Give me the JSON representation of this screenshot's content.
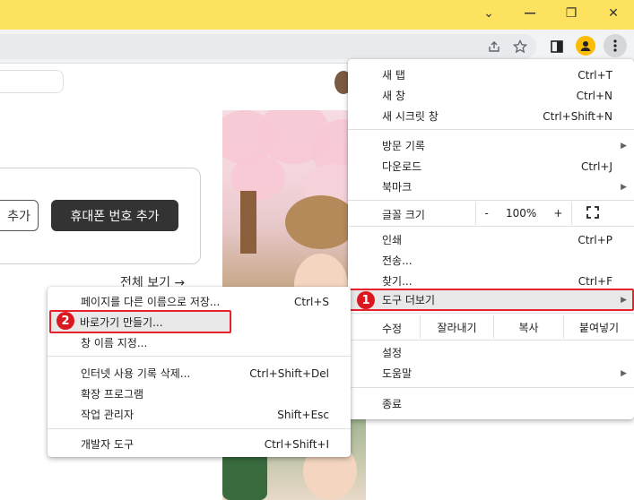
{
  "window": {
    "minimize": "⌄",
    "restore": "❐",
    "close": "✕"
  },
  "toolbar": {
    "share_icon": "share-icon",
    "bookmark_icon": "star-icon",
    "sidepanel_icon": "side-panel-icon",
    "profile_icon": "profile-icon",
    "menu_icon": "kebab-menu-icon"
  },
  "page": {
    "outline_button": "추가",
    "dark_button": "휴대폰 번호 추가",
    "view_all": "전체 보기 →"
  },
  "menu": {
    "new_tab": {
      "label": "새 탭",
      "shortcut": "Ctrl+T"
    },
    "new_window": {
      "label": "새 창",
      "shortcut": "Ctrl+N"
    },
    "incognito": {
      "label": "새 시크릿 창",
      "shortcut": "Ctrl+Shift+N"
    },
    "history": {
      "label": "방문 기록"
    },
    "downloads": {
      "label": "다운로드",
      "shortcut": "Ctrl+J"
    },
    "bookmarks": {
      "label": "북마크"
    },
    "zoom": {
      "label": "글꼴 크기",
      "minus": "-",
      "value": "100%",
      "plus": "+"
    },
    "print": {
      "label": "인쇄",
      "shortcut": "Ctrl+P"
    },
    "cast": {
      "label": "전송..."
    },
    "find": {
      "label": "찾기...",
      "shortcut": "Ctrl+F"
    },
    "more_tools": {
      "label": "도구 더보기"
    },
    "edit": {
      "label": "수정",
      "cut": "잘라내기",
      "copy": "복사",
      "paste": "붙여넣기"
    },
    "settings": {
      "label": "설정"
    },
    "help": {
      "label": "도움말"
    },
    "exit": {
      "label": "종료"
    }
  },
  "submenu": {
    "save_as": {
      "label": "페이지를 다른 이름으로 저장...",
      "shortcut": "Ctrl+S"
    },
    "create_shortcut": {
      "label": "바로가기 만들기..."
    },
    "name_window": {
      "label": "창 이름 지정..."
    },
    "clear_data": {
      "label": "인터넷 사용 기록 삭제...",
      "shortcut": "Ctrl+Shift+Del"
    },
    "extensions": {
      "label": "확장 프로그램"
    },
    "task_manager": {
      "label": "작업 관리자",
      "shortcut": "Shift+Esc"
    },
    "dev_tools": {
      "label": "개발자 도구",
      "shortcut": "Ctrl+Shift+I"
    }
  },
  "annotations": {
    "step1": "1",
    "step2": "2"
  },
  "colors": {
    "titlebar": "#fde25f",
    "highlight": "#e8212b",
    "badge": "#d9181f"
  }
}
